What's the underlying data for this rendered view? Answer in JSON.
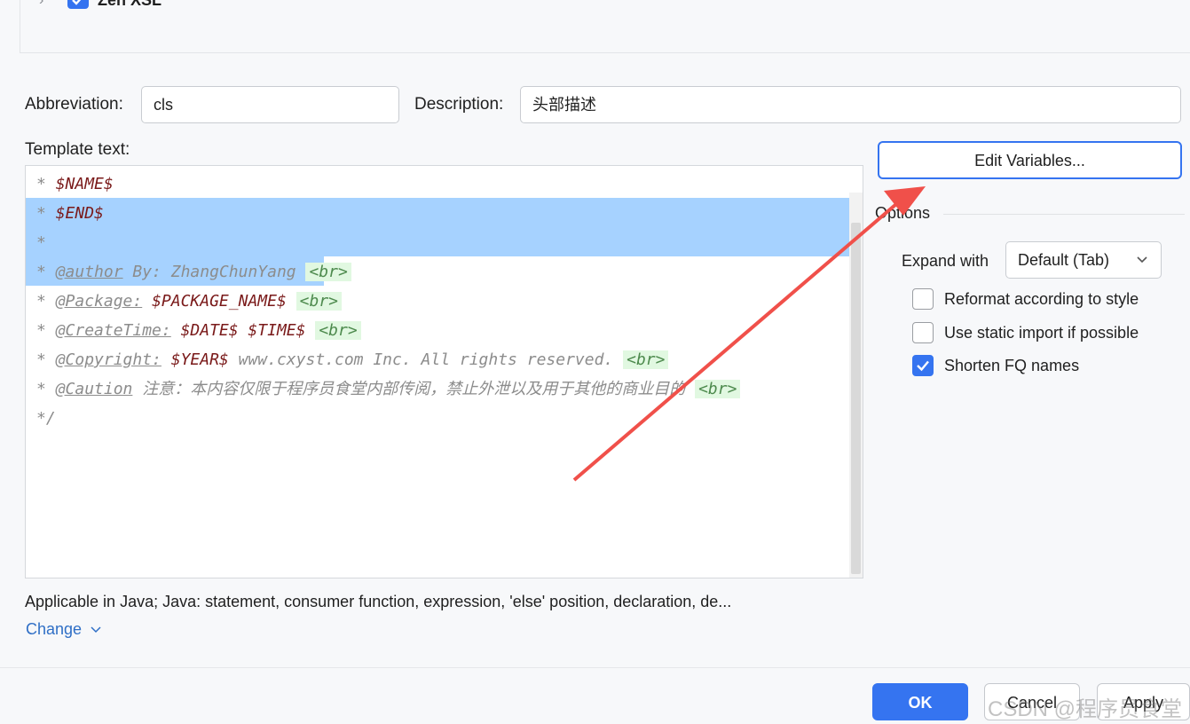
{
  "tree": {
    "item_label": "Zen XSL",
    "checked": true
  },
  "abbreviation": {
    "label": "Abbreviation:",
    "value": "cls"
  },
  "description": {
    "label": "Description:",
    "value": "头部描述"
  },
  "template": {
    "label": "Template text:",
    "lines": [
      {
        "prefix": "* ",
        "parts": [
          {
            "t": "$NAME$",
            "c": "var2"
          }
        ]
      },
      {
        "prefix": "* ",
        "parts": [
          {
            "t": "$END$",
            "c": "var2"
          }
        ]
      },
      {
        "prefix": "*",
        "parts": []
      },
      {
        "prefix": "* ",
        "parts": [
          {
            "t": "@author",
            "c": "tag"
          },
          {
            "t": " By: ZhangChunYang ",
            "c": "plain"
          },
          {
            "t": "<br>",
            "c": "br"
          }
        ]
      },
      {
        "prefix": "* ",
        "parts": [
          {
            "t": "@Package:",
            "c": "tag"
          },
          {
            "t": " ",
            "c": "plain"
          },
          {
            "t": "$PACKAGE_NAME$",
            "c": "var2"
          },
          {
            "t": " ",
            "c": "plain"
          },
          {
            "t": "<br>",
            "c": "br"
          }
        ]
      },
      {
        "prefix": "* ",
        "parts": [
          {
            "t": "@CreateTime:",
            "c": "tag"
          },
          {
            "t": " ",
            "c": "plain"
          },
          {
            "t": "$DATE$ $TIME$",
            "c": "var2"
          },
          {
            "t": " ",
            "c": "plain"
          },
          {
            "t": "<br>",
            "c": "br"
          }
        ]
      },
      {
        "prefix": "* ",
        "parts": [
          {
            "t": "@Copyright:",
            "c": "tag"
          },
          {
            "t": " ",
            "c": "plain"
          },
          {
            "t": "$YEAR$",
            "c": "var2"
          },
          {
            "t": " www.cxyst.com Inc. All rights reserved. ",
            "c": "plain"
          },
          {
            "t": "<br>",
            "c": "br"
          }
        ]
      },
      {
        "prefix": "* ",
        "parts": [
          {
            "t": "@Caution",
            "c": "tag"
          },
          {
            "t": " 注意：本内容仅限于程序员食堂内部传阅，禁止外泄以及用于其他的商业目的 ",
            "c": "plain"
          },
          {
            "t": "<br>",
            "c": "br"
          }
        ]
      },
      {
        "prefix": "*/",
        "parts": []
      }
    ]
  },
  "edit_variables_label": "Edit Variables...",
  "options": {
    "title": "Options",
    "expand_label": "Expand with",
    "expand_value": "Default (Tab)",
    "checkboxes": [
      {
        "label": "Reformat according to style",
        "checked": false
      },
      {
        "label": "Use static import if possible",
        "checked": false
      },
      {
        "label": "Shorten FQ names",
        "checked": true
      }
    ]
  },
  "applicable_text": "Applicable in Java; Java: statement, consumer function, expression, 'else' position, declaration, de...",
  "change_label": "Change",
  "buttons": {
    "ok": "OK",
    "cancel": "Cancel",
    "apply": "Apply"
  },
  "watermark": "CSDN @程序员食堂",
  "colors": {
    "accent": "#3574f0",
    "arrow": "#f0504a",
    "selection": "#a6d2ff",
    "link": "#2f6fc6"
  }
}
